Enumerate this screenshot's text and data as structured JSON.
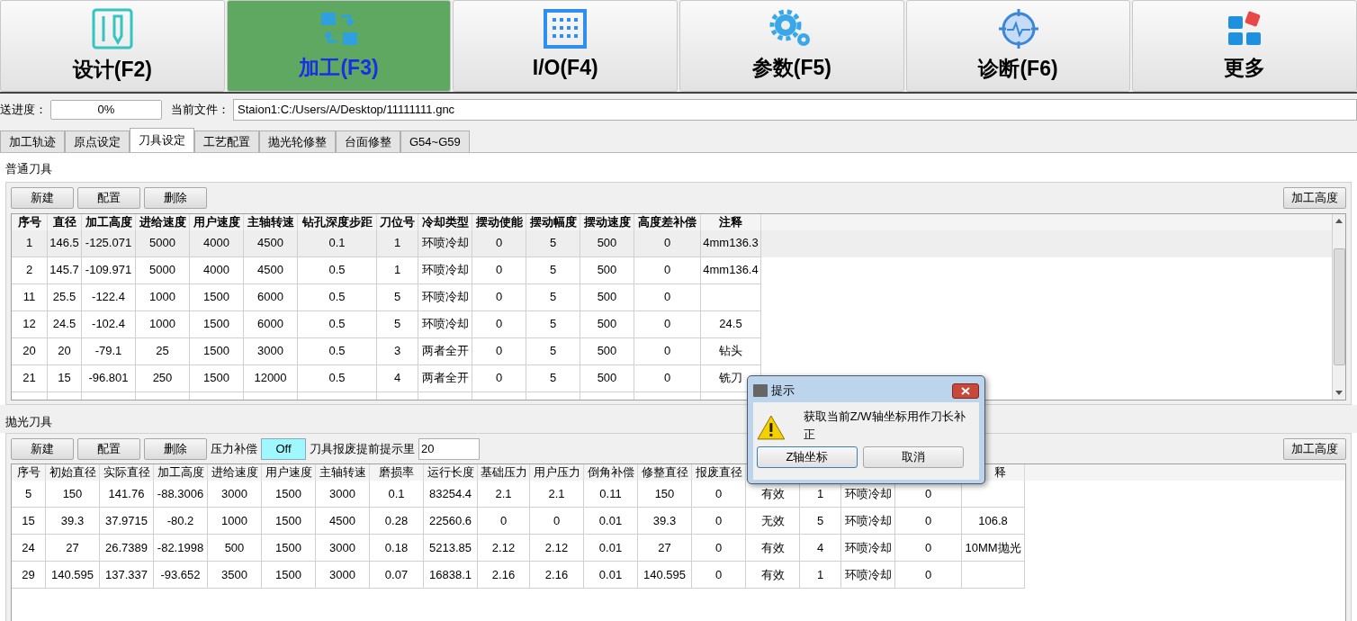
{
  "toolbar": [
    {
      "kind": "design",
      "label": "设计(F2)",
      "selected": false
    },
    {
      "kind": "process",
      "label": "加工(F3)",
      "selected": true
    },
    {
      "kind": "io",
      "label": "I/O(F4)",
      "selected": false
    },
    {
      "kind": "params",
      "label": "参数(F5)",
      "selected": false
    },
    {
      "kind": "diagnose",
      "label": "诊断(F6)",
      "selected": false
    },
    {
      "kind": "more",
      "label": "更多",
      "selected": false
    }
  ],
  "progress": {
    "label": "送进度：",
    "value": "0%",
    "file_label": "当前文件：",
    "file": "Staion1:C:/Users/A/Desktop/11111111.gnc"
  },
  "tabs": [
    {
      "label": "加工轨迹",
      "selected": false
    },
    {
      "label": "原点设定",
      "selected": false
    },
    {
      "label": "刀具设定",
      "selected": true
    },
    {
      "label": "工艺配置",
      "selected": false
    },
    {
      "label": "抛光轮修整",
      "selected": false
    },
    {
      "label": "台面修整",
      "selected": false
    },
    {
      "label": "G54~G59",
      "selected": false
    }
  ],
  "normal_tools": {
    "title": "普通刀具",
    "buttons": [
      "新建",
      "配置",
      "删除"
    ],
    "right_button": "加工高度",
    "columns": [
      "序号",
      "直径",
      "加工高度",
      "进给速度",
      "用户速度",
      "主轴转速",
      "钻孔深度步距",
      "刀位号",
      "冷却类型",
      "摆动使能",
      "摆动幅度",
      "摆动速度",
      "高度差补偿",
      "注释"
    ],
    "rows": [
      {
        "selected": true,
        "cells": [
          "1",
          "146.5",
          "-125.071",
          "5000",
          "4000",
          "4500",
          "0.1",
          "1",
          "环喷冷却",
          "0",
          "5",
          "500",
          "0",
          "4mm136.3"
        ]
      },
      {
        "selected": false,
        "cells": [
          "2",
          "145.7",
          "-109.971",
          "5000",
          "4000",
          "4500",
          "0.5",
          "1",
          "环喷冷却",
          "0",
          "5",
          "500",
          "0",
          "4mm136.4"
        ]
      },
      {
        "selected": false,
        "cells": [
          "11",
          "25.5",
          "-122.4",
          "1000",
          "1500",
          "6000",
          "0.5",
          "5",
          "环喷冷却",
          "0",
          "5",
          "500",
          "0",
          null
        ]
      },
      {
        "selected": false,
        "cells": [
          "12",
          "24.5",
          "-102.4",
          "1000",
          "1500",
          "6000",
          "0.5",
          "5",
          "环喷冷却",
          "0",
          "5",
          "500",
          "0",
          "24.5"
        ]
      },
      {
        "selected": false,
        "cells": [
          "20",
          "20",
          "-79.1",
          "25",
          "1500",
          "3000",
          "0.5",
          "3",
          "两者全开",
          "0",
          "5",
          "500",
          "0",
          "钻头"
        ]
      },
      {
        "selected": false,
        "cells": [
          "21",
          "15",
          "-96.801",
          "250",
          "1500",
          "12000",
          "0.5",
          "4",
          "两者全开",
          "0",
          "5",
          "500",
          "0",
          "铣刀"
        ]
      }
    ]
  },
  "polish_tools": {
    "title": "抛光刀具",
    "buttons": [
      "新建",
      "配置",
      "删除"
    ],
    "pressure_label": "压力补偿",
    "pressure_value": "Off",
    "warn_label": "刀具报废提前提示里",
    "warn_value": "20",
    "right_button": "加工高度",
    "columns": [
      "序号",
      "初始直径",
      "实际直径",
      "加工高度",
      "进给速度",
      "用户速度",
      "主轴转速",
      "磨损率",
      "运行长度",
      "基础压力",
      "用户压力",
      "倒角补偿",
      "修整直径",
      "报废直径"
    ],
    "last_column": "释",
    "rows": [
      {
        "cells": [
          "5",
          "150",
          "141.76",
          "-88.3006",
          "3000",
          "1500",
          "3000",
          "0.1",
          "83254.4",
          "2.1",
          "2.1",
          "0.11",
          "150",
          "0",
          "有效",
          "1",
          "环喷冷却",
          "0",
          null
        ]
      },
      {
        "cells": [
          "15",
          "39.3",
          "37.9715",
          "-80.2",
          "1000",
          "1500",
          "4500",
          "0.28",
          "22560.6",
          "0",
          "0",
          "0.01",
          "39.3",
          "0",
          "无效",
          "5",
          "环喷冷却",
          "0",
          "106.8"
        ]
      },
      {
        "cells": [
          "24",
          "27",
          "26.7389",
          "-82.1998",
          "500",
          "1500",
          "3000",
          "0.18",
          "5213.85",
          "2.12",
          "2.12",
          "0.01",
          "27",
          "0",
          "有效",
          "4",
          "环喷冷却",
          "0",
          "10MM抛光"
        ]
      },
      {
        "cells": [
          "29",
          "140.595",
          "137.337",
          "-93.652",
          "3500",
          "1500",
          "3000",
          "0.07",
          "16838.1",
          "2.16",
          "2.16",
          "0.01",
          "140.595",
          "0",
          "有效",
          "1",
          "环喷冷却",
          "0",
          null
        ]
      }
    ]
  },
  "dialog": {
    "title": "提示",
    "message": "获取当前Z/W轴坐标用作刀长补正",
    "buttons": [
      "Z轴坐标",
      "取消"
    ]
  }
}
